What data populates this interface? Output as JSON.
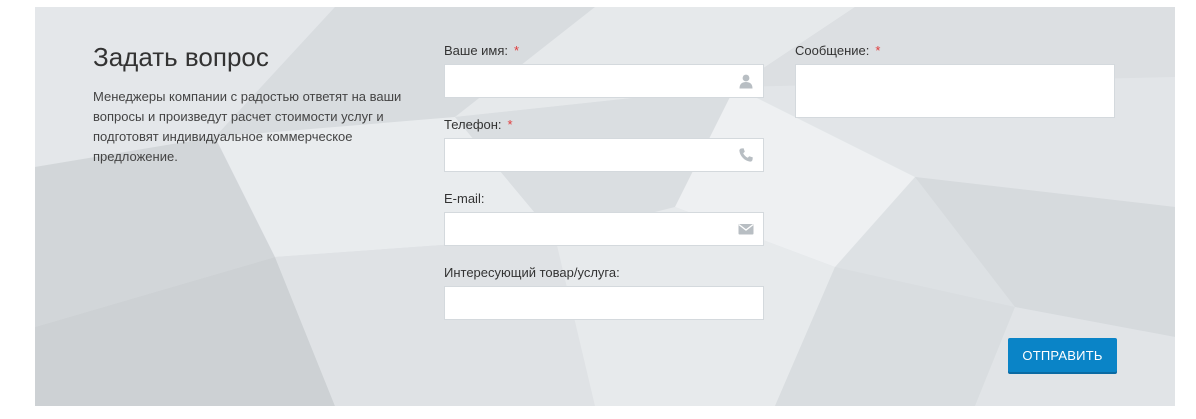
{
  "intro": {
    "title": "Задать вопрос",
    "description": "Менеджеры компании с радостью ответят на ваши вопросы и произведут расчет стоимости услуг и подготовят индивидуальное коммерческое предложение."
  },
  "form": {
    "required_mark": "*",
    "name": {
      "label": "Ваше имя:",
      "required": true,
      "value": "",
      "icon": "user-icon"
    },
    "phone": {
      "label": "Телефон:",
      "required": true,
      "value": "",
      "icon": "phone-icon"
    },
    "email": {
      "label": "E-mail:",
      "required": false,
      "value": "",
      "icon": "envelope-icon"
    },
    "product": {
      "label": "Интересующий товар/услуга:",
      "required": false,
      "value": ""
    },
    "message": {
      "label": "Сообщение:",
      "required": true,
      "value": ""
    },
    "submit_label": "ОТПРАВИТЬ"
  },
  "colors": {
    "panel_bg": "#dfe3e6",
    "accent": "#0a84c7",
    "required": "#e03b3b",
    "icon": "#b8bec3"
  }
}
